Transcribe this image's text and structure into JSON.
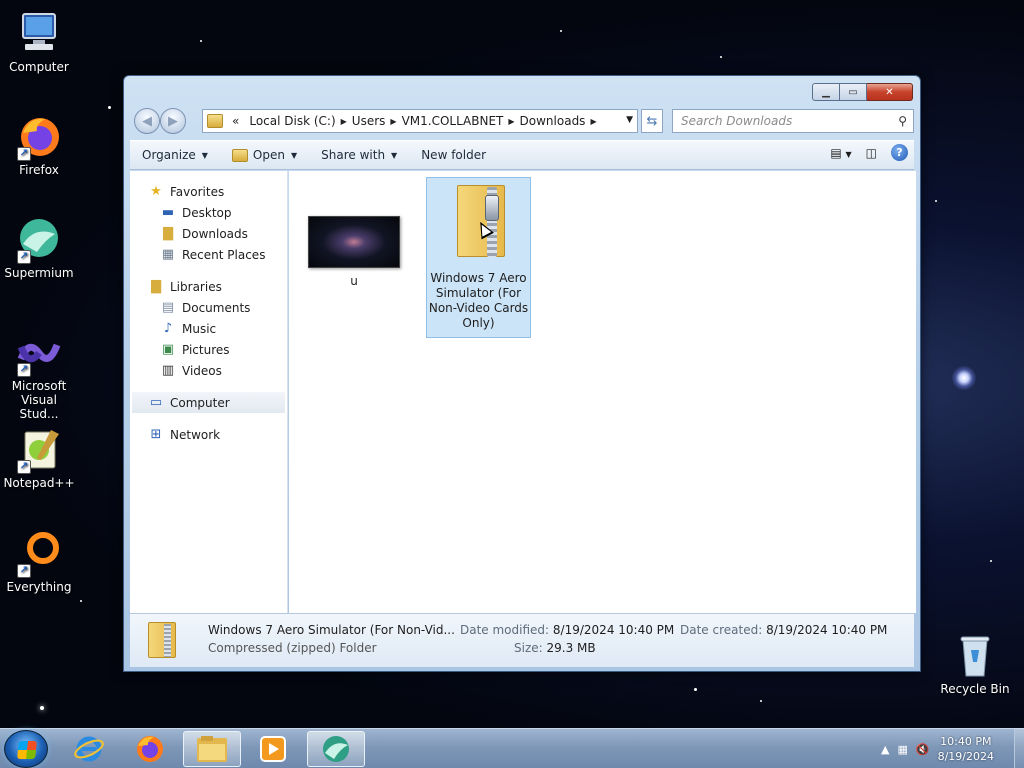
{
  "desktop": {
    "icons": [
      {
        "label": "Computer"
      },
      {
        "label": "Firefox"
      },
      {
        "label": "Supermium"
      },
      {
        "label": "Microsoft Visual Stud..."
      },
      {
        "label": "Notepad++"
      },
      {
        "label": "Everything"
      },
      {
        "label": "Recycle Bin"
      }
    ]
  },
  "explorer": {
    "breadcrumb": {
      "overflow": "«",
      "crumbs": [
        "Local Disk (C:)",
        "Users",
        "VM1.COLLABNET",
        "Downloads"
      ]
    },
    "search": {
      "placeholder": "Search Downloads"
    },
    "toolbar": {
      "organize": "Organize",
      "open": "Open",
      "share_with": "Share with",
      "new_folder": "New folder"
    },
    "nav": {
      "favorites": "Favorites",
      "desktop": "Desktop",
      "downloads": "Downloads",
      "recent_places": "Recent Places",
      "libraries": "Libraries",
      "documents": "Documents",
      "music": "Music",
      "pictures": "Pictures",
      "videos": "Videos",
      "computer": "Computer",
      "network": "Network"
    },
    "files": [
      {
        "name": "u",
        "type": "image"
      },
      {
        "name": "Windows 7 Aero Simulator (For Non-Video Cards Only)",
        "type": "zip",
        "selected": true
      }
    ],
    "details": {
      "name": "Windows 7 Aero Simulator (For Non-Vid...",
      "type": "Compressed (zipped) Folder",
      "date_modified_label": "Date modified:",
      "date_modified": "8/19/2024 10:40 PM",
      "size_label": "Size:",
      "size": "29.3 MB",
      "date_created_label": "Date created:",
      "date_created": "8/19/2024 10:40 PM"
    }
  },
  "taskbar": {
    "clock_time": "10:40 PM",
    "clock_date": "8/19/2024",
    "pinned": [
      "internet-explorer",
      "firefox",
      "windows-explorer",
      "media-player",
      "supermium"
    ]
  },
  "colors": {
    "selection": "#cce4f7",
    "close_button": "#c7432c",
    "window_frame": "#b9d1ea"
  }
}
